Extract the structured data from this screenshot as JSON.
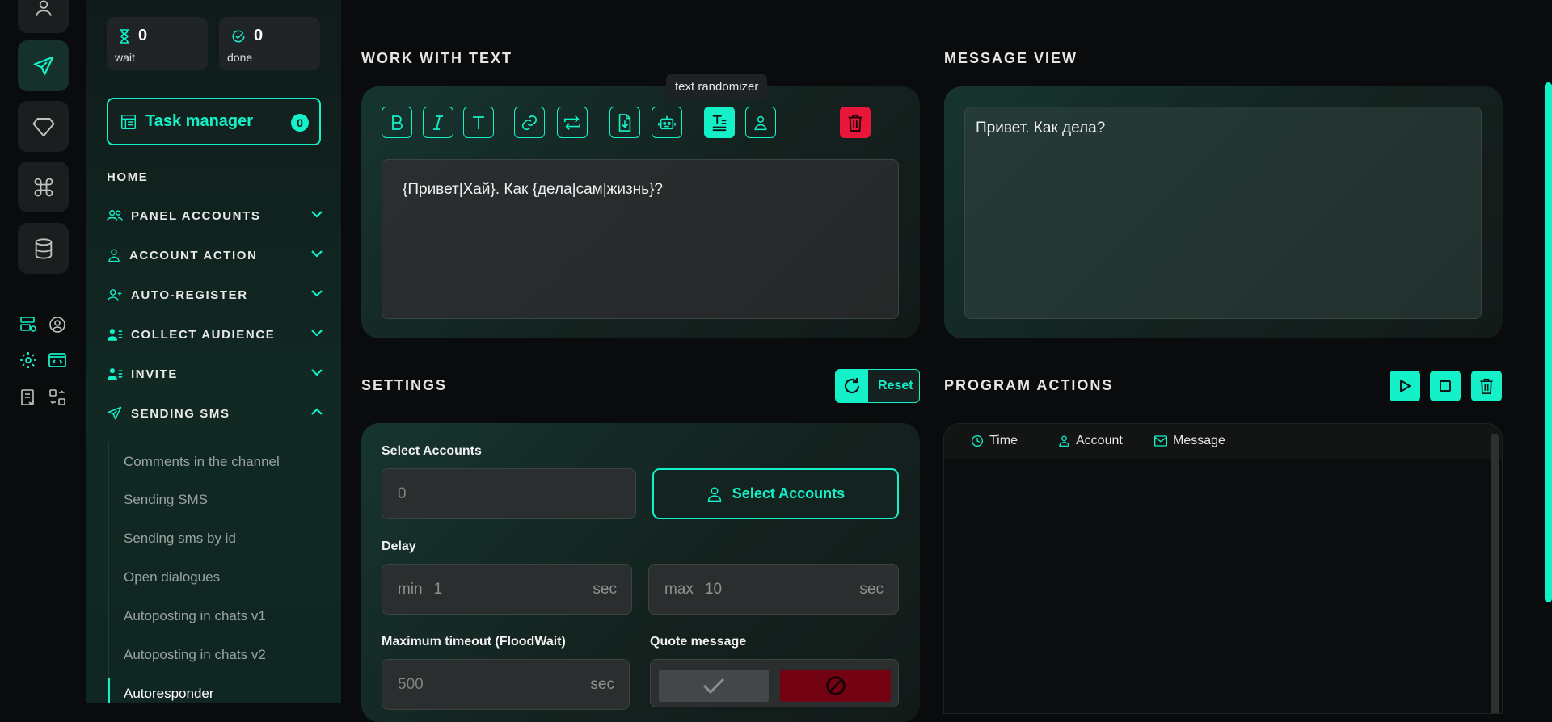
{
  "stats": {
    "wait": {
      "value": "0",
      "label": "wait"
    },
    "done": {
      "value": "0",
      "label": "done"
    }
  },
  "task_manager": {
    "label": "Task manager",
    "count": "0"
  },
  "nav": {
    "home": "HOME",
    "items": [
      {
        "label": "PANEL ACCOUNTS",
        "icon": "users-icon"
      },
      {
        "label": "ACCOUNT ACTION",
        "icon": "user-icon"
      },
      {
        "label": "AUTO-REGISTER",
        "icon": "user-plus-icon"
      },
      {
        "label": "COLLECT AUDIENCE",
        "icon": "user-list-icon"
      },
      {
        "label": "INVITE",
        "icon": "user-list-icon"
      },
      {
        "label": "SENDING SMS",
        "icon": "send-icon"
      }
    ],
    "sub_items": [
      "Comments in the channel",
      "Sending SMS",
      "Sending sms by id",
      "Open dialogues",
      "Autoposting in chats v1",
      "Autoposting in chats v2",
      "Autoresponder"
    ]
  },
  "work_with_text": {
    "title": "WORK WITH TEXT",
    "tooltip": "text randomizer",
    "editor_text": "{Привет|Хай}. Как {дела|сам|жизнь}?"
  },
  "message_view": {
    "title": "MESSAGE VIEW",
    "preview_text": "Привет. Как дела?"
  },
  "settings": {
    "title": "SETTINGS",
    "reset_label": "Reset",
    "select_accounts_label": "Select Accounts",
    "select_accounts_placeholder": "0",
    "select_accounts_button": "Select Accounts",
    "delay_label": "Delay",
    "delay_min_prefix": "min",
    "delay_min_value": "1",
    "delay_max_prefix": "max",
    "delay_max_value": "10",
    "unit": "sec",
    "timeout_label": "Maximum timeout (FloodWait)",
    "timeout_placeholder": "500",
    "quote_label": "Quote message"
  },
  "program_actions": {
    "title": "PROGRAM ACTIONS",
    "columns": [
      "Time",
      "Account",
      "Message"
    ]
  },
  "colors": {
    "accent": "#14f0c8",
    "danger": "#e8173a",
    "background": "#0a0b0c"
  }
}
